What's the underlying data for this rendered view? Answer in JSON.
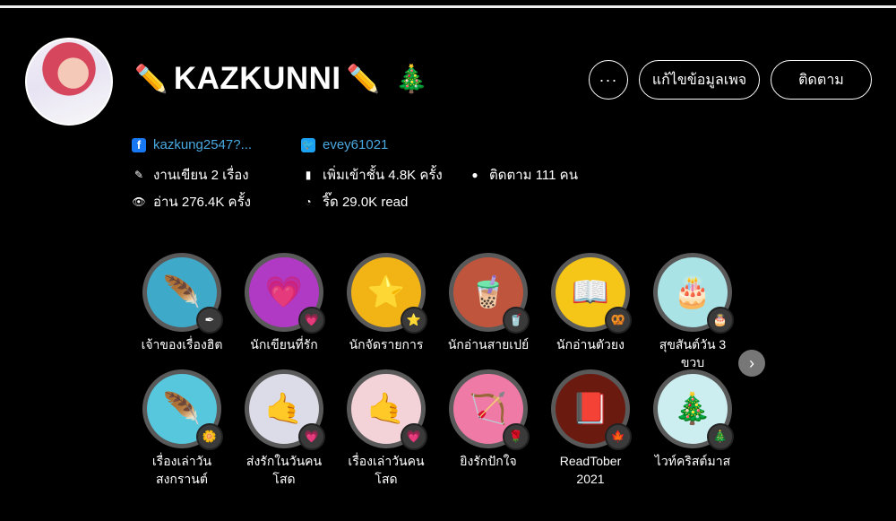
{
  "profile": {
    "name": "KAZKUNNI",
    "name_icon_left": "pencil-icon",
    "name_icon_right": "pencil-icon",
    "name_decoration": "holly-icon"
  },
  "actions": {
    "more_label": "···",
    "edit_label": "แก้ไขข้อมูลเพจ",
    "follow_label": "ติดตาม"
  },
  "social": {
    "facebook": "kazkung2547?...",
    "twitter": "evey61021"
  },
  "stats": {
    "works": "งานเขียน 2 เรื่อง",
    "shelved": "เพิ่มเข้าชั้น 4.8K ครั้ง",
    "followers": "ติดตาม 111 คน",
    "reads": "อ่าน 276.4K ครั้ง",
    "ric": "ริ๊ด 29.0K read"
  },
  "badges": [
    {
      "label": "เจ้าของเรื่องฮิต",
      "icon": "feather-icon",
      "mini": "quill-icon",
      "bg": "#3fa9c9"
    },
    {
      "label": "นักเขียนที่รัก",
      "icon": "heart-icon",
      "mini": "heart-icon",
      "bg": "#b03ac4"
    },
    {
      "label": "นักจัดรายการ",
      "icon": "star-icon",
      "mini": "star-icon",
      "bg": "#f2b315"
    },
    {
      "label": "นักอ่านสายเปย์",
      "icon": "bubble-tea-icon",
      "mini": "tea-icon",
      "bg": "#c0553d"
    },
    {
      "label": "นักอ่านตัวยง",
      "icon": "book-icon",
      "mini": "pretzel-icon",
      "bg": "#f5c518"
    },
    {
      "label": "สุขสันต์วัน 3 ขวบ",
      "icon": "cake-icon",
      "mini": "cake-icon",
      "bg": "#a9e3e6"
    },
    {
      "label": "เรื่องเล่าวันสงกรานต์",
      "icon": "feather-icon",
      "mini": "flower-icon",
      "bg": "#57c7de"
    },
    {
      "label": "ส่งรักในวันคนโสด",
      "icon": "hand-heart-icon",
      "mini": "heart-icon",
      "bg": "#dcdce8"
    },
    {
      "label": "เรื่องเล่าวันคนโสด",
      "icon": "hand-heart-icon",
      "mini": "heart-icon",
      "bg": "#f3d3d8"
    },
    {
      "label": "ยิงรักปักใจ",
      "icon": "bow-arrow-icon",
      "mini": "rose-icon",
      "bg": "#f07aa6"
    },
    {
      "label": "ReadTober 2021",
      "icon": "readtober-icon",
      "mini": "leaf-icon",
      "bg": "#6b1a10"
    },
    {
      "label": "ไวท์คริสต์มาส",
      "icon": "christmas-tree-icon",
      "mini": "holly-icon",
      "bg": "#cdeef0"
    }
  ],
  "nav": {
    "next_icon": "chevron-right-icon"
  }
}
